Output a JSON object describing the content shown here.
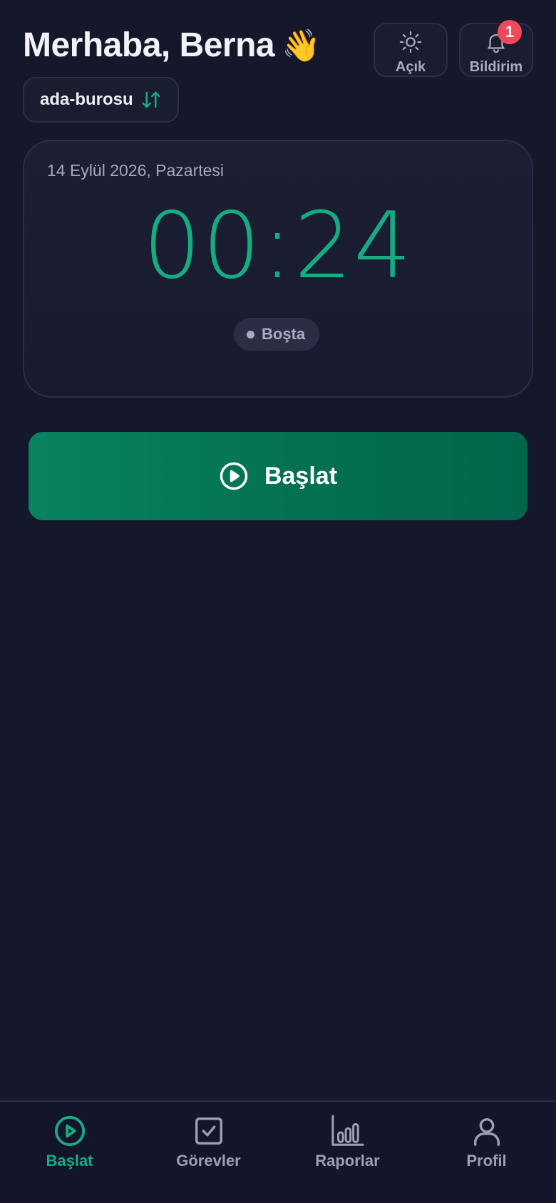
{
  "header": {
    "greeting": "Merhaba, Berna",
    "greeting_emoji": "👋",
    "workspace": "ada-burosu",
    "theme_label": "Açık",
    "notifications_label": "Bildirim",
    "notifications_count": "1"
  },
  "timer": {
    "date": "14 Eylül 2026, Pazartesi",
    "time": "00:24",
    "status": "Boşta"
  },
  "actions": {
    "start_label": "Başlat"
  },
  "nav": {
    "items": [
      {
        "label": "Başlat",
        "icon": "play-circle-icon",
        "active": true
      },
      {
        "label": "Görevler",
        "icon": "checkbox-icon",
        "active": false
      },
      {
        "label": "Raporlar",
        "icon": "bar-chart-icon",
        "active": false
      },
      {
        "label": "Profil",
        "icon": "user-icon",
        "active": false
      }
    ]
  },
  "colors": {
    "background": "#15172a",
    "accent": "#14ad82",
    "button": "#07845f",
    "badge": "#f04a5a",
    "muted": "#9b9eb5"
  }
}
